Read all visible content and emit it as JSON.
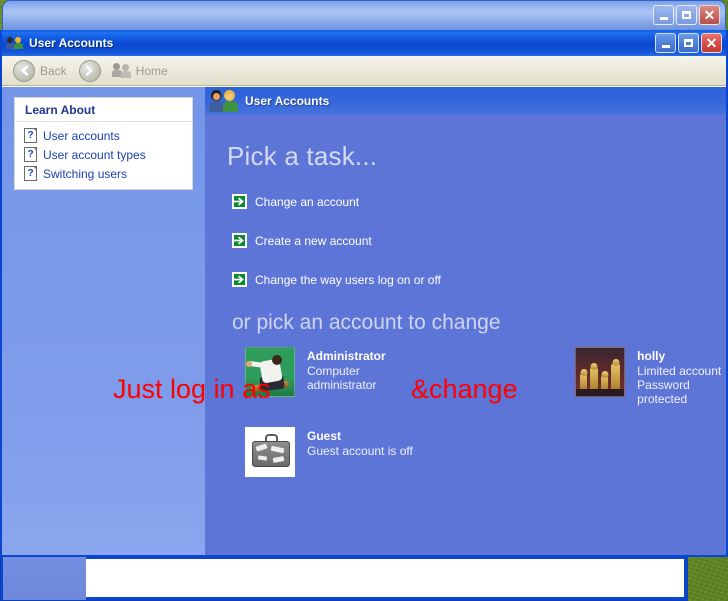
{
  "desktop": {
    "wallpaper_color": "#6d9227"
  },
  "background_window": {
    "title": "",
    "caption_buttons": [
      {
        "name": "minimize",
        "glyph": "_"
      },
      {
        "name": "maximize",
        "glyph": "□"
      },
      {
        "name": "close",
        "glyph": "×"
      }
    ]
  },
  "window": {
    "title": "User Accounts",
    "title_icon": "users-icon",
    "accent_color": "#0a46d0",
    "caption_buttons": [
      {
        "name": "minimize",
        "glyph": "_"
      },
      {
        "name": "maximize",
        "glyph": "□"
      },
      {
        "name": "close",
        "glyph": "×"
      }
    ]
  },
  "toolbar": {
    "back_label": "Back",
    "back_icon": "arrow-left-icon",
    "forward_icon": "arrow-right-icon",
    "home_label": "Home",
    "home_icon": "users-icon"
  },
  "sidebar": {
    "panel_title": "Learn About",
    "items": [
      {
        "label": "User accounts",
        "icon": "help-question-icon"
      },
      {
        "label": "User account types",
        "icon": "help-question-icon"
      },
      {
        "label": "Switching users",
        "icon": "help-question-icon"
      }
    ]
  },
  "main": {
    "header_title": "User Accounts",
    "header_icon": "users-icon",
    "task_heading": "Pick a task...",
    "tasks": [
      {
        "label": "Change an account",
        "icon": "green-arrow-icon"
      },
      {
        "label": "Create a new account",
        "icon": "green-arrow-icon"
      },
      {
        "label": "Change the way users log on or off",
        "icon": "green-arrow-icon"
      }
    ],
    "accounts_heading": "or pick an account to change",
    "accounts": [
      {
        "name": "Administrator",
        "lines": [
          "Computer administrator"
        ],
        "avatar": "skateboarder-avatar"
      },
      {
        "name": "holly",
        "lines": [
          "Limited account",
          "Password protected"
        ],
        "avatar": "chess-pieces-avatar"
      },
      {
        "name": "Guest",
        "lines": [
          "Guest account is off"
        ],
        "avatar": "suitcase-avatar"
      }
    ]
  },
  "annotations": {
    "color": "#ff0000",
    "text_1": "Just log in as",
    "text_2": "&change"
  }
}
